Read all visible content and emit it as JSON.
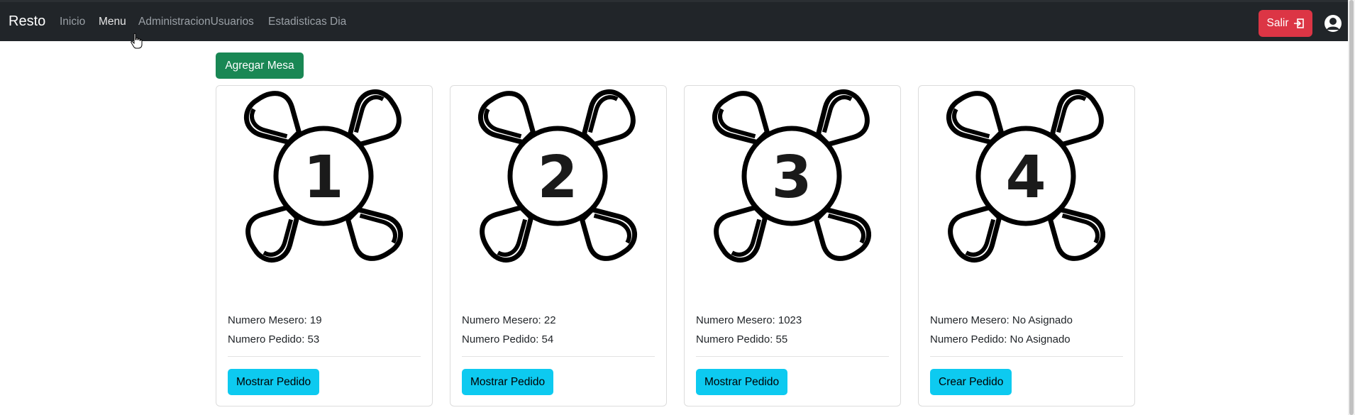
{
  "navbar": {
    "brand": "Resto",
    "links": [
      {
        "label": "Inicio"
      },
      {
        "label": "Menu"
      },
      {
        "label": "AdministracionUsuarios"
      },
      {
        "label": "Estadisticas Dia"
      }
    ],
    "logout_label": "Salir"
  },
  "actions": {
    "add_table_label": "Agregar Mesa"
  },
  "tables": [
    {
      "number": "1",
      "waiter_line": "Numero Mesero: 19",
      "order_line": "Numero Pedido: 53",
      "button_label": "Mostrar Pedido"
    },
    {
      "number": "2",
      "waiter_line": "Numero Mesero: 22",
      "order_line": "Numero Pedido: 54",
      "button_label": "Mostrar Pedido"
    },
    {
      "number": "3",
      "waiter_line": "Numero Mesero: 1023",
      "order_line": "Numero Pedido: 55",
      "button_label": "Mostrar Pedido"
    },
    {
      "number": "4",
      "waiter_line": "Numero Mesero: No Asignado",
      "order_line": "Numero Pedido: No Asignado",
      "button_label": "Crear Pedido"
    }
  ],
  "colors": {
    "navbar": "#212529",
    "danger": "#dc3545",
    "success": "#198754",
    "info": "#0dcaf0"
  },
  "icons": [
    "table-icon",
    "logout-icon",
    "user-avatar-icon",
    "pointer-cursor-icon"
  ]
}
